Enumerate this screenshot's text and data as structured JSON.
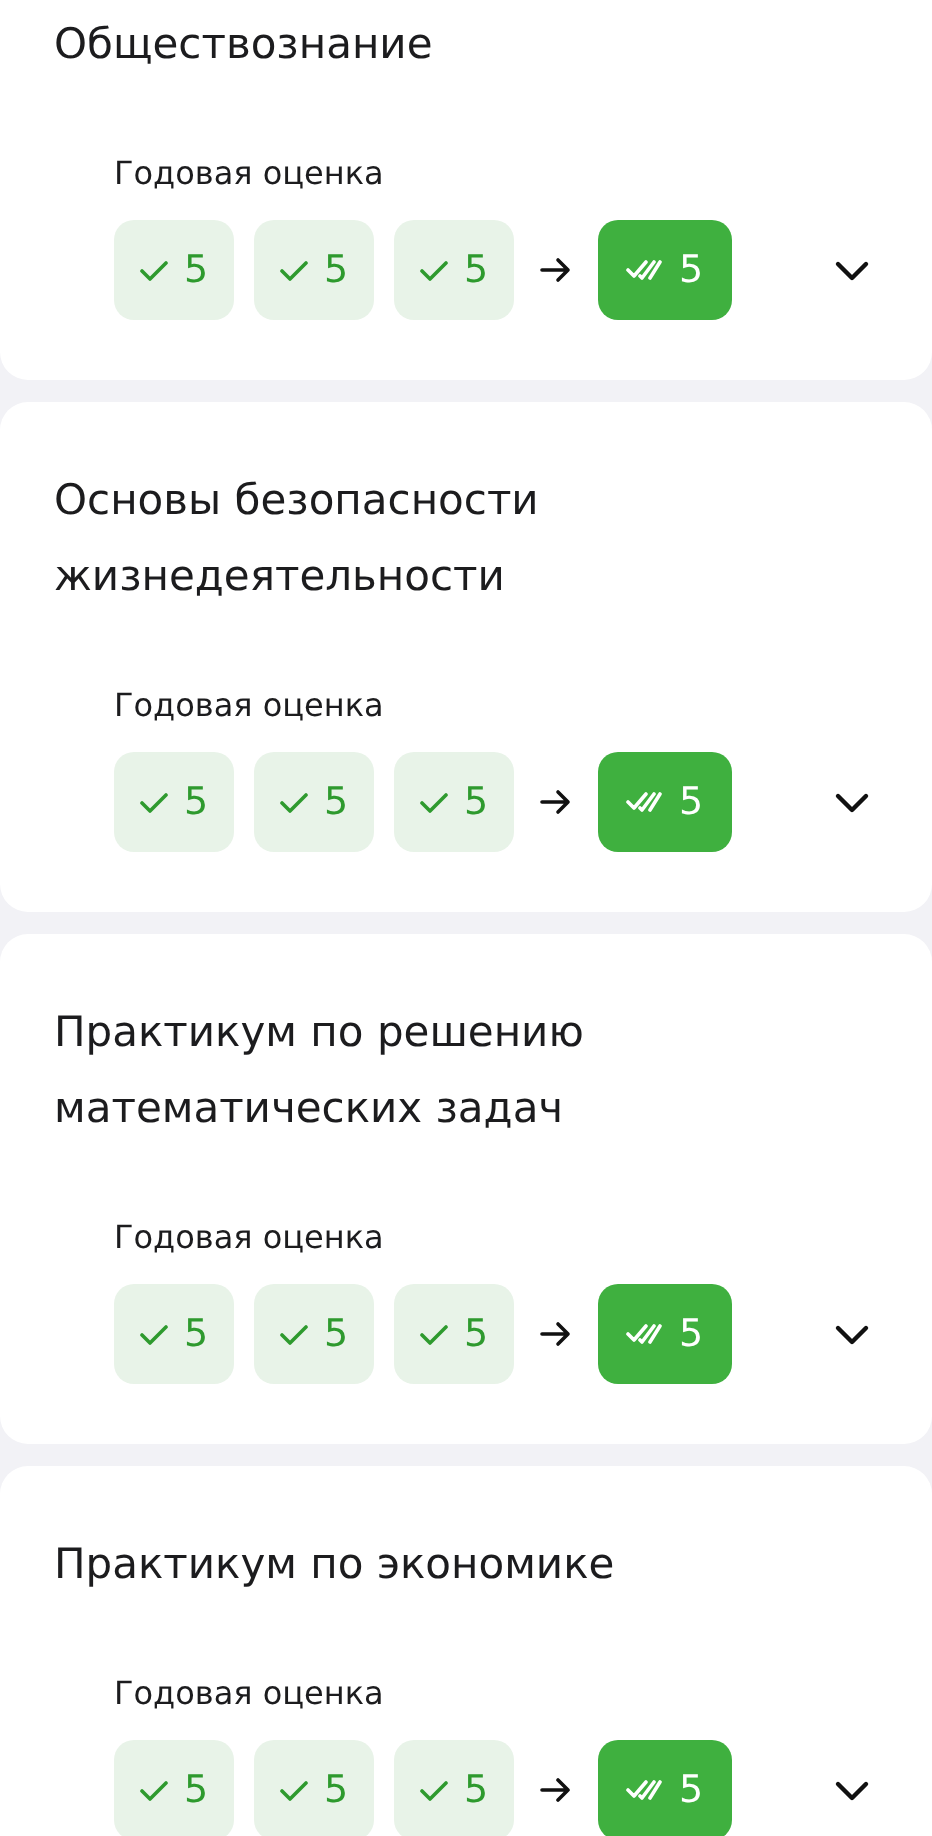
{
  "subjects": [
    {
      "title": "Обществознание",
      "label": "Годовая оценка",
      "expanded": false,
      "grades": [
        {
          "kind": "term",
          "value": "5"
        },
        {
          "kind": "term",
          "value": "5"
        },
        {
          "kind": "term",
          "value": "5"
        },
        {
          "kind": "final",
          "value": "5"
        }
      ]
    },
    {
      "title": "Основы безопасности жизнедеятельности",
      "label": "Годовая оценка",
      "expanded": false,
      "grades": [
        {
          "kind": "term",
          "value": "5"
        },
        {
          "kind": "term",
          "value": "5"
        },
        {
          "kind": "term",
          "value": "5"
        },
        {
          "kind": "final",
          "value": "5"
        }
      ]
    },
    {
      "title": "Практикум по решению математических задач",
      "label": "Годовая оценка",
      "expanded": false,
      "grades": [
        {
          "kind": "term",
          "value": "5"
        },
        {
          "kind": "term",
          "value": "5"
        },
        {
          "kind": "term",
          "value": "5"
        },
        {
          "kind": "final",
          "value": "5"
        }
      ]
    },
    {
      "title": "Практикум по экономике",
      "label": "Годовая оценка",
      "expanded": false,
      "grades": [
        {
          "kind": "term",
          "value": "5"
        },
        {
          "kind": "term",
          "value": "5"
        },
        {
          "kind": "term",
          "value": "5"
        },
        {
          "kind": "final",
          "value": "5"
        }
      ]
    }
  ]
}
